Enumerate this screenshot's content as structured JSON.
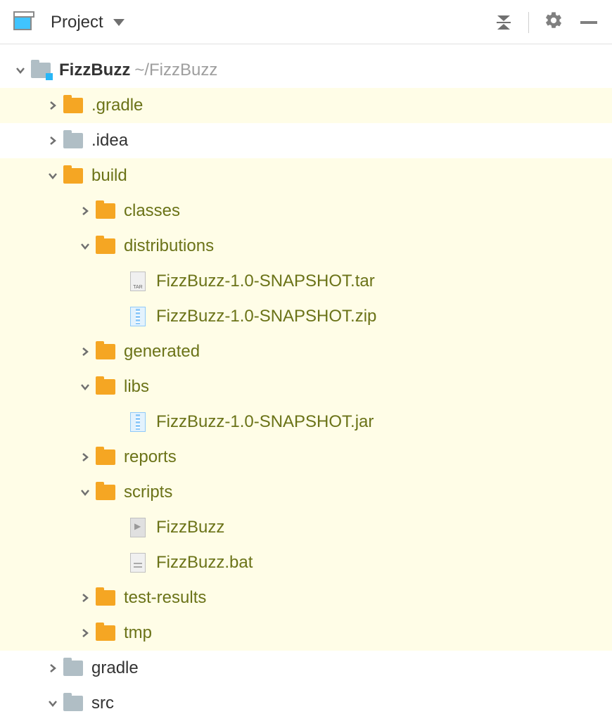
{
  "header": {
    "title": "Project"
  },
  "tree": {
    "root": {
      "name": "FizzBuzz",
      "path": "~/FizzBuzz"
    },
    "nodes": {
      "gradle_dot": ".gradle",
      "idea": ".idea",
      "build": "build",
      "classes": "classes",
      "distributions": "distributions",
      "dist_tar": "FizzBuzz-1.0-SNAPSHOT.tar",
      "dist_zip": "FizzBuzz-1.0-SNAPSHOT.zip",
      "generated": "generated",
      "libs": "libs",
      "libs_jar": "FizzBuzz-1.0-SNAPSHOT.jar",
      "reports": "reports",
      "scripts": "scripts",
      "script_sh": "FizzBuzz",
      "script_bat": "FizzBuzz.bat",
      "test_results": "test-results",
      "tmp": "tmp",
      "gradle": "gradle",
      "src": "src"
    }
  }
}
